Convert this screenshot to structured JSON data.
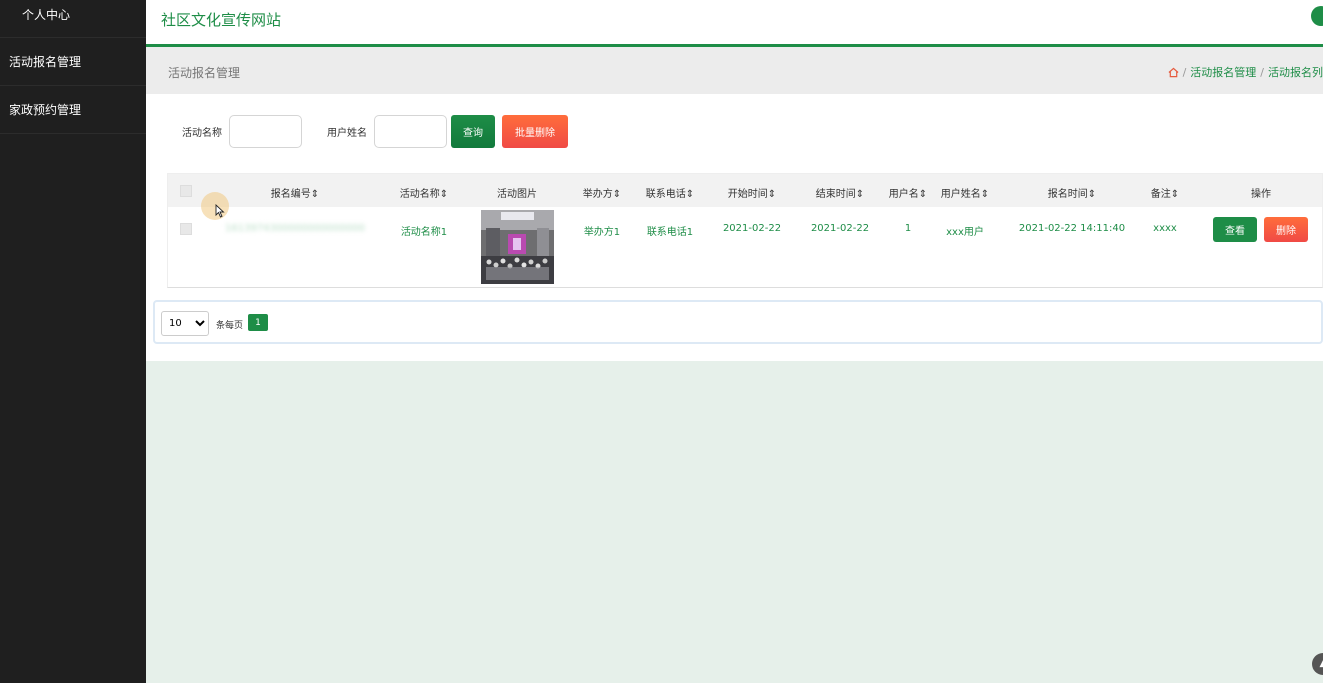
{
  "sidebar": {
    "items": [
      {
        "label": "个人中心"
      },
      {
        "label": "活动报名管理"
      },
      {
        "label": "家政预约管理"
      }
    ]
  },
  "header": {
    "site_title": "社区文化宣传网站"
  },
  "breadcrumb": {
    "page_title": "活动报名管理",
    "path": [
      "活动报名管理",
      "活动报名列"
    ],
    "separator": "/"
  },
  "search": {
    "fields": [
      {
        "label": "活动名称",
        "value": ""
      },
      {
        "label": "用户姓名",
        "value": ""
      }
    ],
    "query_label": "查询",
    "bulk_delete_label": "批量删除"
  },
  "table": {
    "columns": [
      "报名编号",
      "活动名称",
      "活动图片",
      "举办方",
      "联系电话",
      "开始时间",
      "结束时间",
      "用户名",
      "用户姓名",
      "报名时间",
      "备注",
      "操作"
    ],
    "sort_icon": "⇕",
    "rows": [
      {
        "id": "1613974300000000000000",
        "activity_name": "活动名称1",
        "image": "activity-photo",
        "organizer": "举办方1",
        "phone": "联系电话1",
        "start_time": "2021-02-22",
        "end_time": "2021-02-22",
        "username": "1",
        "user_fullname": "xxx用户",
        "signup_time": "2021-02-22 14:11:40",
        "remark": "xxxx",
        "view_label": "查看",
        "delete_label": "删除"
      }
    ]
  },
  "pagination": {
    "page_size": "10",
    "page_size_options": [
      "10"
    ],
    "per_page_label": "条每页",
    "current_page": "1"
  },
  "colors": {
    "brand_green": "#1e8d47",
    "danger": "#f04a45",
    "sidebar_bg": "#1f1f1f"
  }
}
